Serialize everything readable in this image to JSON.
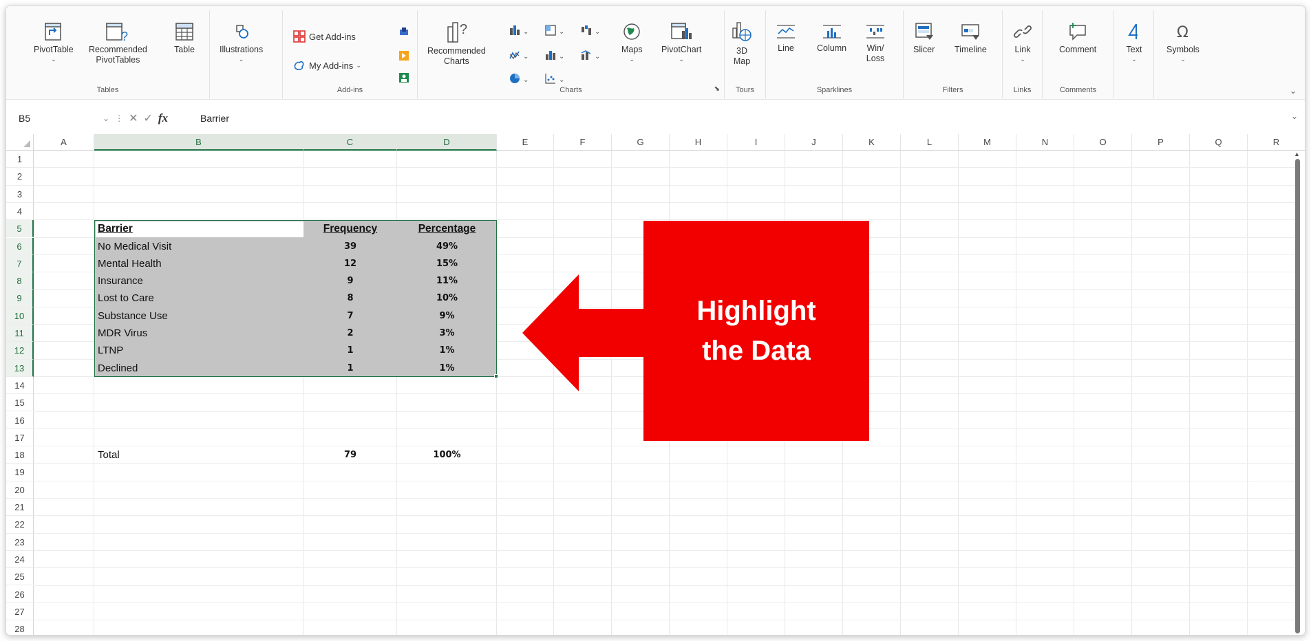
{
  "ribbon": {
    "groups": {
      "tables": "Tables",
      "addins": "Add-ins",
      "charts": "Charts",
      "tours": "Tours",
      "sparklines": "Sparklines",
      "filters": "Filters",
      "links": "Links",
      "comments": "Comments"
    },
    "buttons": {
      "pivottable": "PivotTable",
      "recommended_pivottables_1": "Recommended",
      "recommended_pivottables_2": "PivotTables",
      "table": "Table",
      "illustrations": "Illustrations",
      "get_addins": "Get Add-ins",
      "my_addins": "My Add-ins",
      "recommended_charts_1": "Recommended",
      "recommended_charts_2": "Charts",
      "maps": "Maps",
      "pivotchart": "PivotChart",
      "map3d_1": "3D",
      "map3d_2": "Map",
      "line": "Line",
      "column": "Column",
      "winloss_1": "Win/",
      "winloss_2": "Loss",
      "slicer": "Slicer",
      "timeline": "Timeline",
      "link": "Link",
      "comment": "Comment",
      "text": "Text",
      "symbols": "Symbols"
    }
  },
  "formula_bar": {
    "name_box": "B5",
    "fx": "fx",
    "value": "Barrier"
  },
  "columns": [
    "A",
    "B",
    "C",
    "D",
    "E",
    "F",
    "G",
    "H",
    "I",
    "J",
    "K",
    "L",
    "M",
    "N",
    "O",
    "P",
    "Q",
    "R"
  ],
  "rows": [
    "1",
    "2",
    "3",
    "4",
    "5",
    "6",
    "7",
    "8",
    "9",
    "10",
    "11",
    "12",
    "13",
    "14",
    "15",
    "16",
    "17",
    "18",
    "19",
    "20",
    "21",
    "22",
    "23",
    "24",
    "25",
    "26",
    "27",
    "28"
  ],
  "table": {
    "headers": {
      "barrier": "Barrier",
      "frequency": "Frequency",
      "percentage": "Percentage"
    },
    "rows": [
      {
        "barrier": "No Medical Visit",
        "frequency": "39",
        "percentage": "49%"
      },
      {
        "barrier": "Mental Health",
        "frequency": "12",
        "percentage": "15%"
      },
      {
        "barrier": "Insurance",
        "frequency": "9",
        "percentage": "11%"
      },
      {
        "barrier": "Lost to Care",
        "frequency": "8",
        "percentage": "10%"
      },
      {
        "barrier": "Substance Use",
        "frequency": "7",
        "percentage": "9%"
      },
      {
        "barrier": "MDR Virus",
        "frequency": "2",
        "percentage": "3%"
      },
      {
        "barrier": "LTNP",
        "frequency": "1",
        "percentage": "1%"
      },
      {
        "barrier": "Declined",
        "frequency": "1",
        "percentage": "1%"
      }
    ],
    "total": {
      "label": "Total",
      "frequency": "79",
      "percentage": "100%"
    }
  },
  "callout": {
    "line1": "Highlight",
    "line2": "the Data",
    "color": "#f20000"
  },
  "accent_color": "#217346",
  "selection_fill": "#c4c4c4"
}
